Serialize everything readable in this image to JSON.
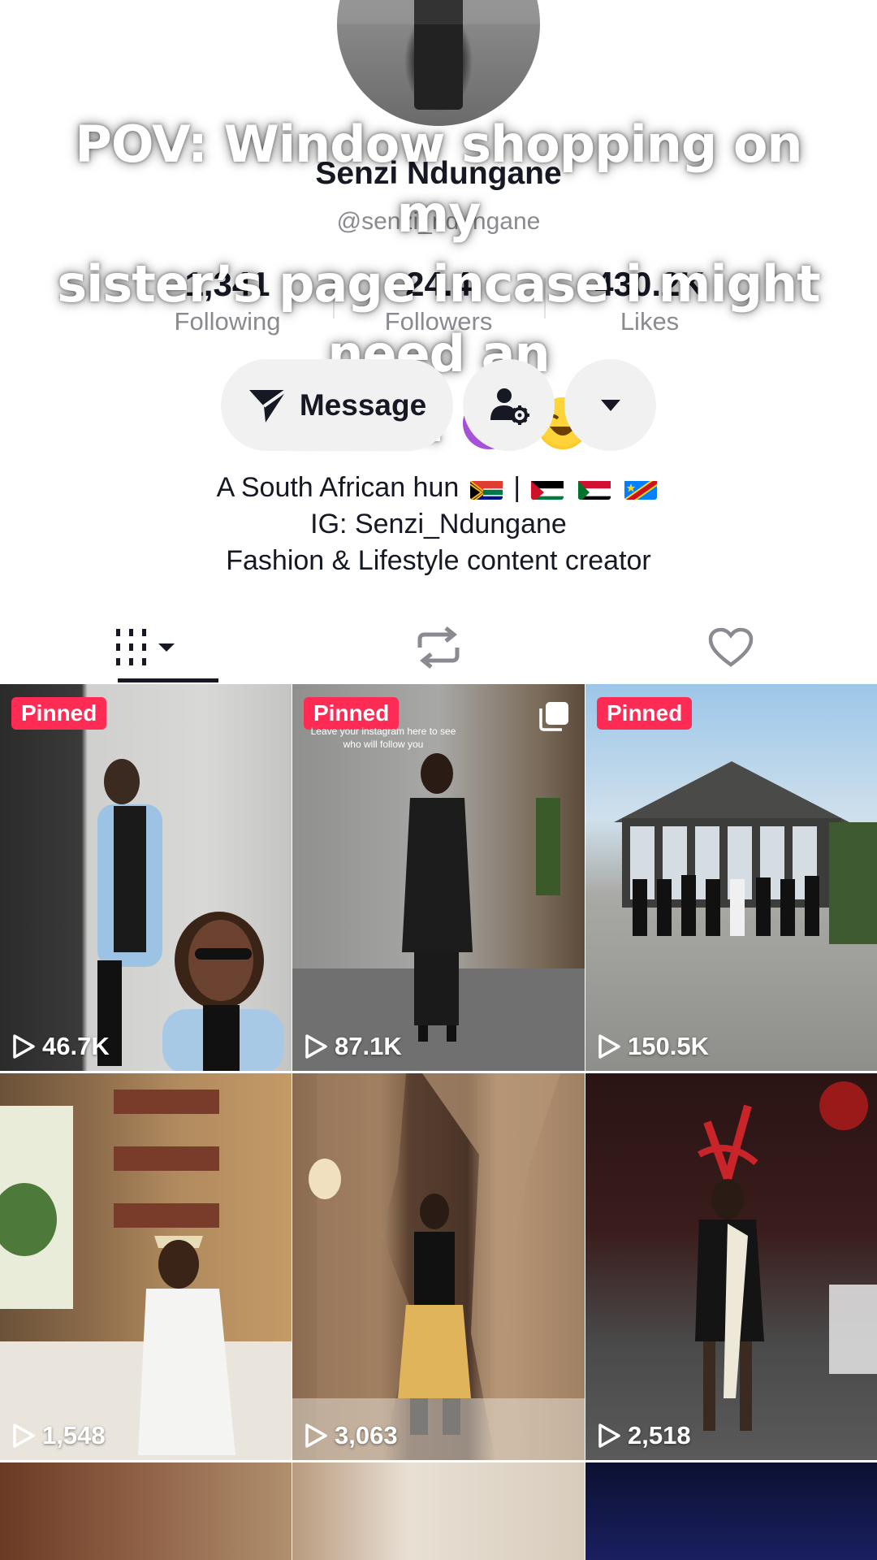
{
  "profile": {
    "name": "Senzi Ndungane",
    "handle": "@senzi_ndungane"
  },
  "stats": [
    {
      "value": "1,341",
      "label": "Following"
    },
    {
      "value": "24.4",
      "label": "Followers"
    },
    {
      "value": "430.2K",
      "label": "Likes"
    }
  ],
  "overlay_caption": {
    "line1": "POV: Window shopping on my",
    "line2": "sister’s page incase i might need an",
    "line3": "outfit"
  },
  "buttons": {
    "message": "Message"
  },
  "bio": {
    "line1": "A South African hun",
    "separator": "|",
    "line2": "IG: Senzi_Ndungane",
    "line3": "Fashion & Lifestyle content creator"
  },
  "videos": [
    {
      "badge": "Pinned",
      "views": "46.7K"
    },
    {
      "badge": "Pinned",
      "views": "87.1K",
      "caption": "Leave your instagram here to see who will follow you"
    },
    {
      "badge": "Pinned",
      "views": "150.5K"
    },
    {
      "views": "1,548"
    },
    {
      "views": "3,063"
    },
    {
      "views": "2,518"
    }
  ],
  "colors": {
    "accent": "#fe2c55",
    "text": "#161823",
    "secondary_text": "#8a8b91",
    "button_bg": "#f1f1f2"
  }
}
